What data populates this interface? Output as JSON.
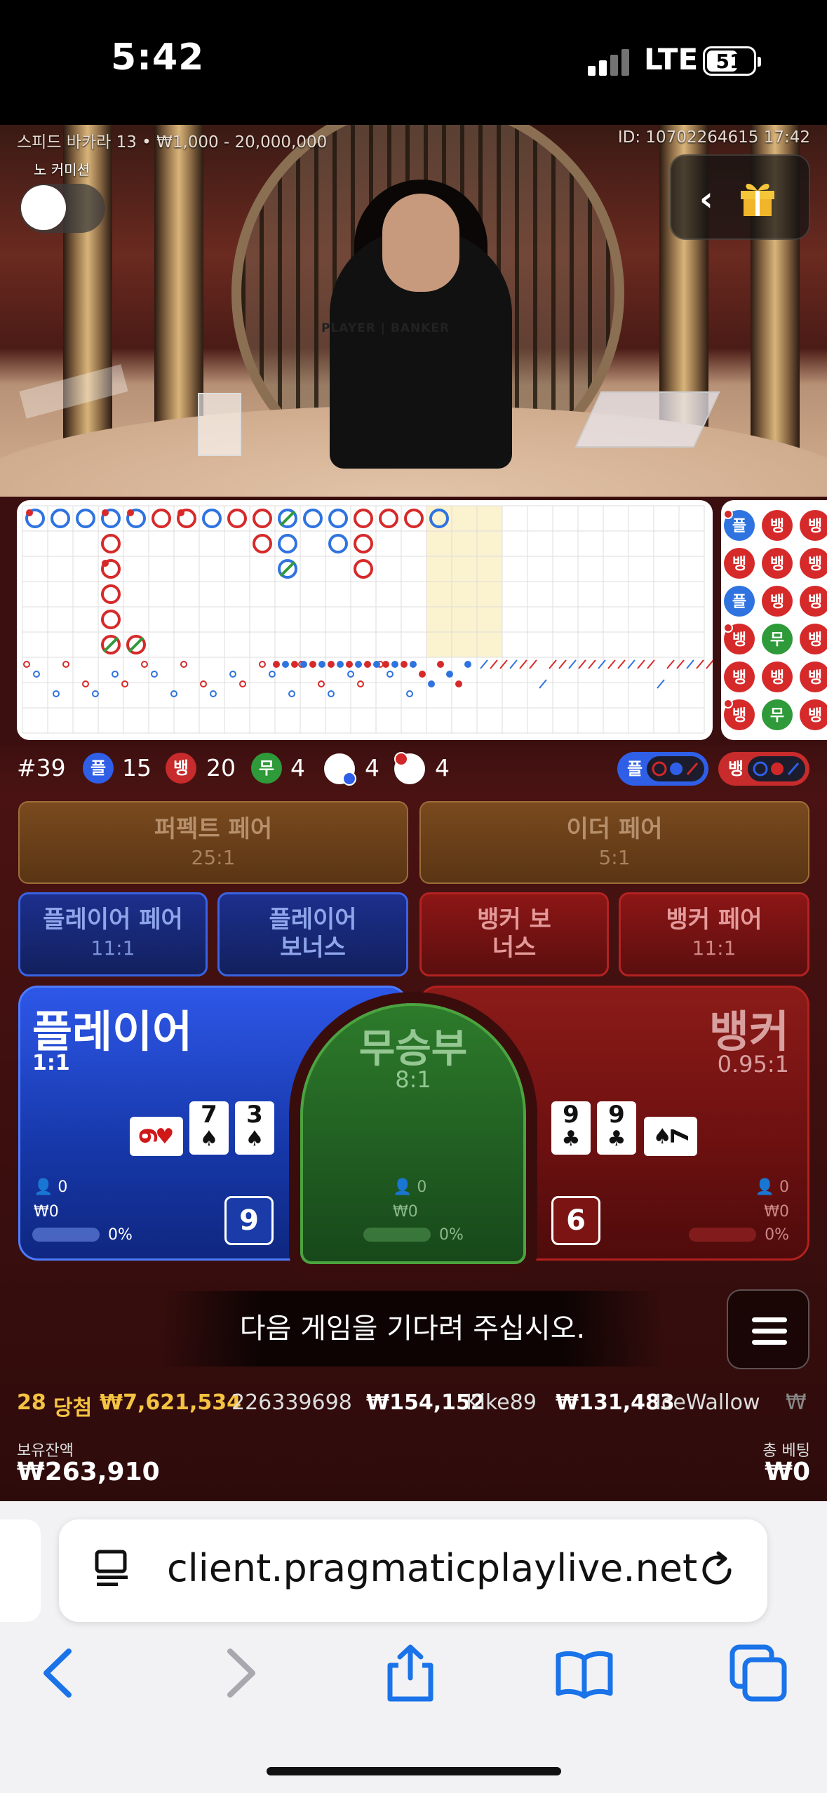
{
  "status_bar": {
    "time": "5:42",
    "network": "LTE",
    "battery": "51"
  },
  "video": {
    "game_info": "스피드 바카라 13 • ₩1,000 - 20,000,000",
    "round_id": "ID: 10702264615 17:42",
    "no_commission_label": "노 커미션",
    "table_text": "PLAYER | BANKER"
  },
  "stats": {
    "round": "#39",
    "player_label": "플",
    "player_count": "15",
    "banker_label": "뱅",
    "banker_count": "20",
    "tie_label": "무",
    "tie_count": "4",
    "player_pair_count": "4",
    "banker_pair_count": "4",
    "predict_player": "플",
    "predict_banker": "뱅"
  },
  "side_bets": {
    "perfect_pair": {
      "label": "퍼펙트 페어",
      "odds": "25:1"
    },
    "either_pair": {
      "label": "이더 페어",
      "odds": "5:1"
    },
    "player_pair": {
      "label": "플레이어 페어",
      "odds": "11:1"
    },
    "player_bonus": {
      "label": "플레이어 보너스"
    },
    "banker_bonus": {
      "label": "뱅커 보너스"
    },
    "banker_pair": {
      "label": "뱅커 페어",
      "odds": "11:1"
    }
  },
  "main_bets": {
    "player": {
      "label": "플레이어",
      "odds": "1:1",
      "score": "9",
      "players": "0",
      "amount": "₩0",
      "percent": "0%",
      "cards": [
        {
          "rank": "6",
          "suit": "♥",
          "color": "#d01818"
        },
        {
          "rank": "7",
          "suit": "♠",
          "color": "#111"
        },
        {
          "rank": "3",
          "suit": "♠",
          "color": "#111"
        }
      ]
    },
    "tie": {
      "label": "무승부",
      "odds": "8:1",
      "players": "0",
      "amount": "₩0",
      "percent": "0%"
    },
    "banker": {
      "label": "뱅커",
      "odds": "0.95:1",
      "score": "6",
      "players": "0",
      "amount": "₩0",
      "percent": "0%",
      "cards": [
        {
          "rank": "9",
          "suit": "♣",
          "color": "#111"
        },
        {
          "rank": "9",
          "suit": "♣",
          "color": "#111"
        },
        {
          "rank": "7",
          "suit": "♠",
          "color": "#111"
        }
      ]
    }
  },
  "message": "다음 게임을 기다려 주십시오.",
  "winners": {
    "count": "28",
    "label": "당첨",
    "total": "₩7,621,534",
    "entries": [
      {
        "amount": "",
        "name": "226339698"
      },
      {
        "amount": "₩154,152",
        "name": "Kike89"
      },
      {
        "amount": "₩131,483",
        "name": "IceWallow"
      },
      {
        "amount": "₩",
        "name": ""
      }
    ]
  },
  "balance": {
    "label": "보유잔액",
    "value": "₩263,910"
  },
  "total_bet": {
    "label": "총 베팅",
    "value": "₩0"
  },
  "browser": {
    "url": "client.pragmaticplaylive.net"
  },
  "colors": {
    "player": "#2f5fe6",
    "banker": "#c72b2b",
    "tie": "#2f9a3a",
    "gold": "#f5c342"
  },
  "roadmap": {
    "big_road": [
      [
        "bp",
        "b",
        "b",
        "bp",
        "bp",
        "r",
        "rp",
        "b",
        "r",
        "r",
        "bt",
        "b",
        "b",
        "r",
        "r",
        "r",
        "b"
      ],
      [
        "",
        "",
        "",
        "r",
        "",
        "",
        "",
        "",
        "",
        "r",
        "b",
        "",
        "b",
        "r",
        "",
        "",
        "",
        ""
      ],
      [
        "",
        "",
        "",
        "rp",
        "",
        "",
        "",
        "",
        "",
        "",
        "bt",
        "",
        "",
        "r",
        "",
        "",
        "",
        ""
      ],
      [
        "",
        "",
        "",
        "r",
        "",
        "",
        "",
        "",
        "",
        "",
        "",
        "",
        "",
        "",
        "",
        "",
        "",
        ""
      ],
      [
        "",
        "",
        "",
        "r",
        "",
        "",
        "",
        "",
        "",
        "",
        "",
        "",
        "",
        "",
        "",
        "",
        "",
        ""
      ],
      [
        "",
        "",
        "",
        "rt",
        "rt",
        "",
        "",
        "",
        "",
        "",
        "",
        "",
        "",
        "",
        "",
        "",
        "",
        ""
      ]
    ],
    "bead_plate": [
      [
        "플p",
        "뱅",
        "뱅"
      ],
      [
        "뱅",
        "뱅",
        "뱅"
      ],
      [
        "플",
        "뱅",
        "뱅"
      ],
      [
        "뱅p",
        "무",
        "뱅"
      ],
      [
        "뱅",
        "뱅",
        "뱅"
      ],
      [
        "뱅p",
        "무",
        "뱅"
      ]
    ]
  }
}
